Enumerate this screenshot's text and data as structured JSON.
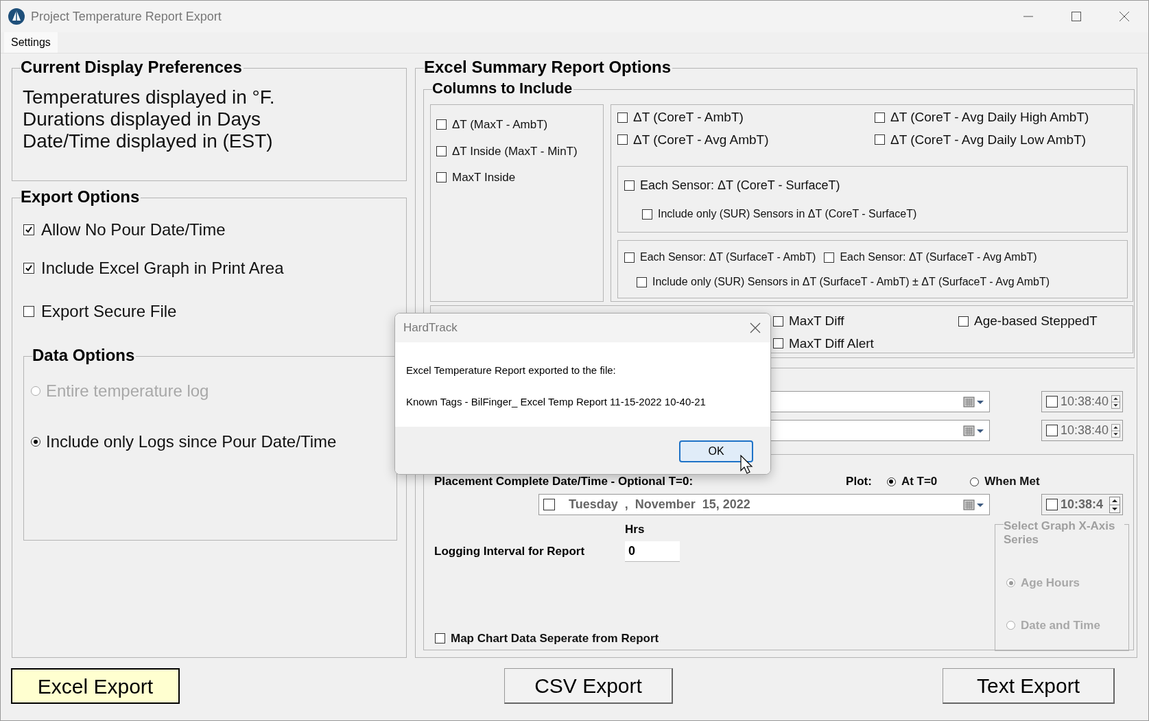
{
  "window": {
    "title": "Project Temperature Report Export"
  },
  "menu": [
    {
      "label": "Settings"
    }
  ],
  "display_preferences": {
    "title": "Current Display Preferences",
    "lines": [
      "Temperatures displayed in °F.",
      "Durations displayed in Days",
      "Date/Time displayed in (EST)"
    ]
  },
  "export_options": {
    "title": "Export Options",
    "options": [
      {
        "label": "Allow No Pour Date/Time",
        "checked": true
      },
      {
        "label": "Include Excel Graph in Print Area",
        "checked": true
      },
      {
        "label": "Export Secure File",
        "checked": false
      }
    ]
  },
  "data_options": {
    "title": "Data Options",
    "options": [
      {
        "label": "Entire temperature log",
        "selected": false,
        "disabled": true
      },
      {
        "label": "Include only Logs since Pour Date/Time",
        "selected": true,
        "disabled": false
      }
    ]
  },
  "excel_summary": {
    "title": "Excel Summary Report Options",
    "columns": {
      "title": "Columns to Include",
      "basic": [
        {
          "label": "ΔT (MaxT - AmbT)",
          "checked": false
        },
        {
          "label": "ΔT Inside (MaxT - MinT)",
          "checked": false
        },
        {
          "label": "MaxT Inside",
          "checked": false
        }
      ],
      "core": [
        {
          "label": "ΔT (CoreT - AmbT)",
          "checked": false
        },
        {
          "label": "ΔT (CoreT - Avg Daily High AmbT)",
          "checked": false
        },
        {
          "label": "ΔT (CoreT - Avg AmbT)",
          "checked": false
        },
        {
          "label": "ΔT (CoreT - Avg Daily Low AmbT)",
          "checked": false
        }
      ],
      "core_surface": {
        "label": "Each Sensor: ΔT (CoreT - SurfaceT)",
        "checked": false
      },
      "core_surface_sur_only": {
        "label": "Include only (SUR) Sensors in ΔT (CoreT - SurfaceT)",
        "checked": false
      },
      "surface_ambient": [
        {
          "label": "Each Sensor: ΔT (SurfaceT - AmbT)",
          "checked": false
        },
        {
          "label": "Each Sensor: ΔT (SurfaceT - Avg AmbT)",
          "checked": false
        }
      ],
      "surface_ambient_sur_only": {
        "label": "Include only (SUR) Sensors in ΔT (SurfaceT - AmbT) ± ΔT (SurfaceT - Avg AmbT)",
        "checked": false
      },
      "diff": [
        {
          "label": "MaxT Diff",
          "checked": false
        },
        {
          "label": "MaxT Diff Alert",
          "checked": false
        },
        {
          "label": "Age-based SteppedT",
          "checked": false
        }
      ]
    },
    "date_rows": [
      {
        "time": "10:38:40",
        "time_checked": false
      },
      {
        "time": "10:38:40",
        "time_checked": false
      }
    ],
    "placement": {
      "label": "Placement Complete Date/Time - Optional T=0:",
      "plot_label": "Plot:",
      "plot_options": [
        {
          "label": "At T=0",
          "selected": true
        },
        {
          "label": "When Met",
          "selected": false
        }
      ],
      "date": "Tuesday  ,  November  15, 2022",
      "date_checked": false,
      "time": "10:38:4",
      "time_checked": false
    },
    "logging": {
      "unit": "Hrs",
      "label": "Logging Interval for Report",
      "value": "0"
    },
    "map_chart": {
      "label": "Map Chart Data Seperate from Report",
      "checked": false
    },
    "x_axis": {
      "title": "Select Graph X-Axis Series",
      "options": [
        {
          "label": "Age Hours",
          "selected": true
        },
        {
          "label": "Date and Time",
          "selected": false
        }
      ]
    }
  },
  "buttons": [
    {
      "label": "Excel Export",
      "highlighted": true
    },
    {
      "label": "CSV Export",
      "highlighted": false
    },
    {
      "label": "Text Export",
      "highlighted": false
    }
  ],
  "dialog": {
    "title": "HardTrack",
    "message": "Excel Temperature Report exported to the file:",
    "file": "Known Tags - BilFinger_ Excel Temp Report 11-15-2022 10-40-21",
    "ok": "OK"
  }
}
